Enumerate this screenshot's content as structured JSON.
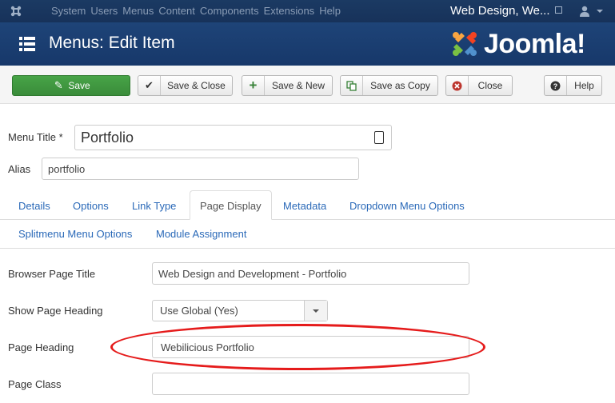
{
  "topnav": {
    "items": [
      "System",
      "Users",
      "Menus",
      "Content",
      "Components",
      "Extensions",
      "Help"
    ],
    "site_name": "Web Design, We..."
  },
  "titlebar": {
    "title": "Menus: Edit Item",
    "brand": "Joomla!"
  },
  "toolbar": {
    "save": "Save",
    "save_close": "Save & Close",
    "save_new": "Save & New",
    "save_copy": "Save as Copy",
    "close": "Close",
    "help": "Help"
  },
  "form": {
    "menu_title_label": "Menu Title *",
    "menu_title_value": "Portfolio",
    "alias_label": "Alias",
    "alias_value": "portfolio"
  },
  "tabs": [
    "Details",
    "Options",
    "Link Type",
    "Page Display",
    "Metadata",
    "Dropdown Menu Options",
    "Splitmenu Menu Options",
    "Module Assignment"
  ],
  "page_display": {
    "browser_title_label": "Browser Page Title",
    "browser_title_value": "Web Design and Development - Portfolio",
    "show_heading_label": "Show Page Heading",
    "show_heading_value": "Use Global (Yes)",
    "page_heading_label": "Page Heading",
    "page_heading_value": "Webilicious Portfolio",
    "page_class_label": "Page Class",
    "page_class_value": ""
  },
  "colors": {
    "nav_bg": "#17325a",
    "save_green": "#47a447",
    "link_blue": "#2a69b8",
    "highlight_red": "#e51b1b"
  }
}
